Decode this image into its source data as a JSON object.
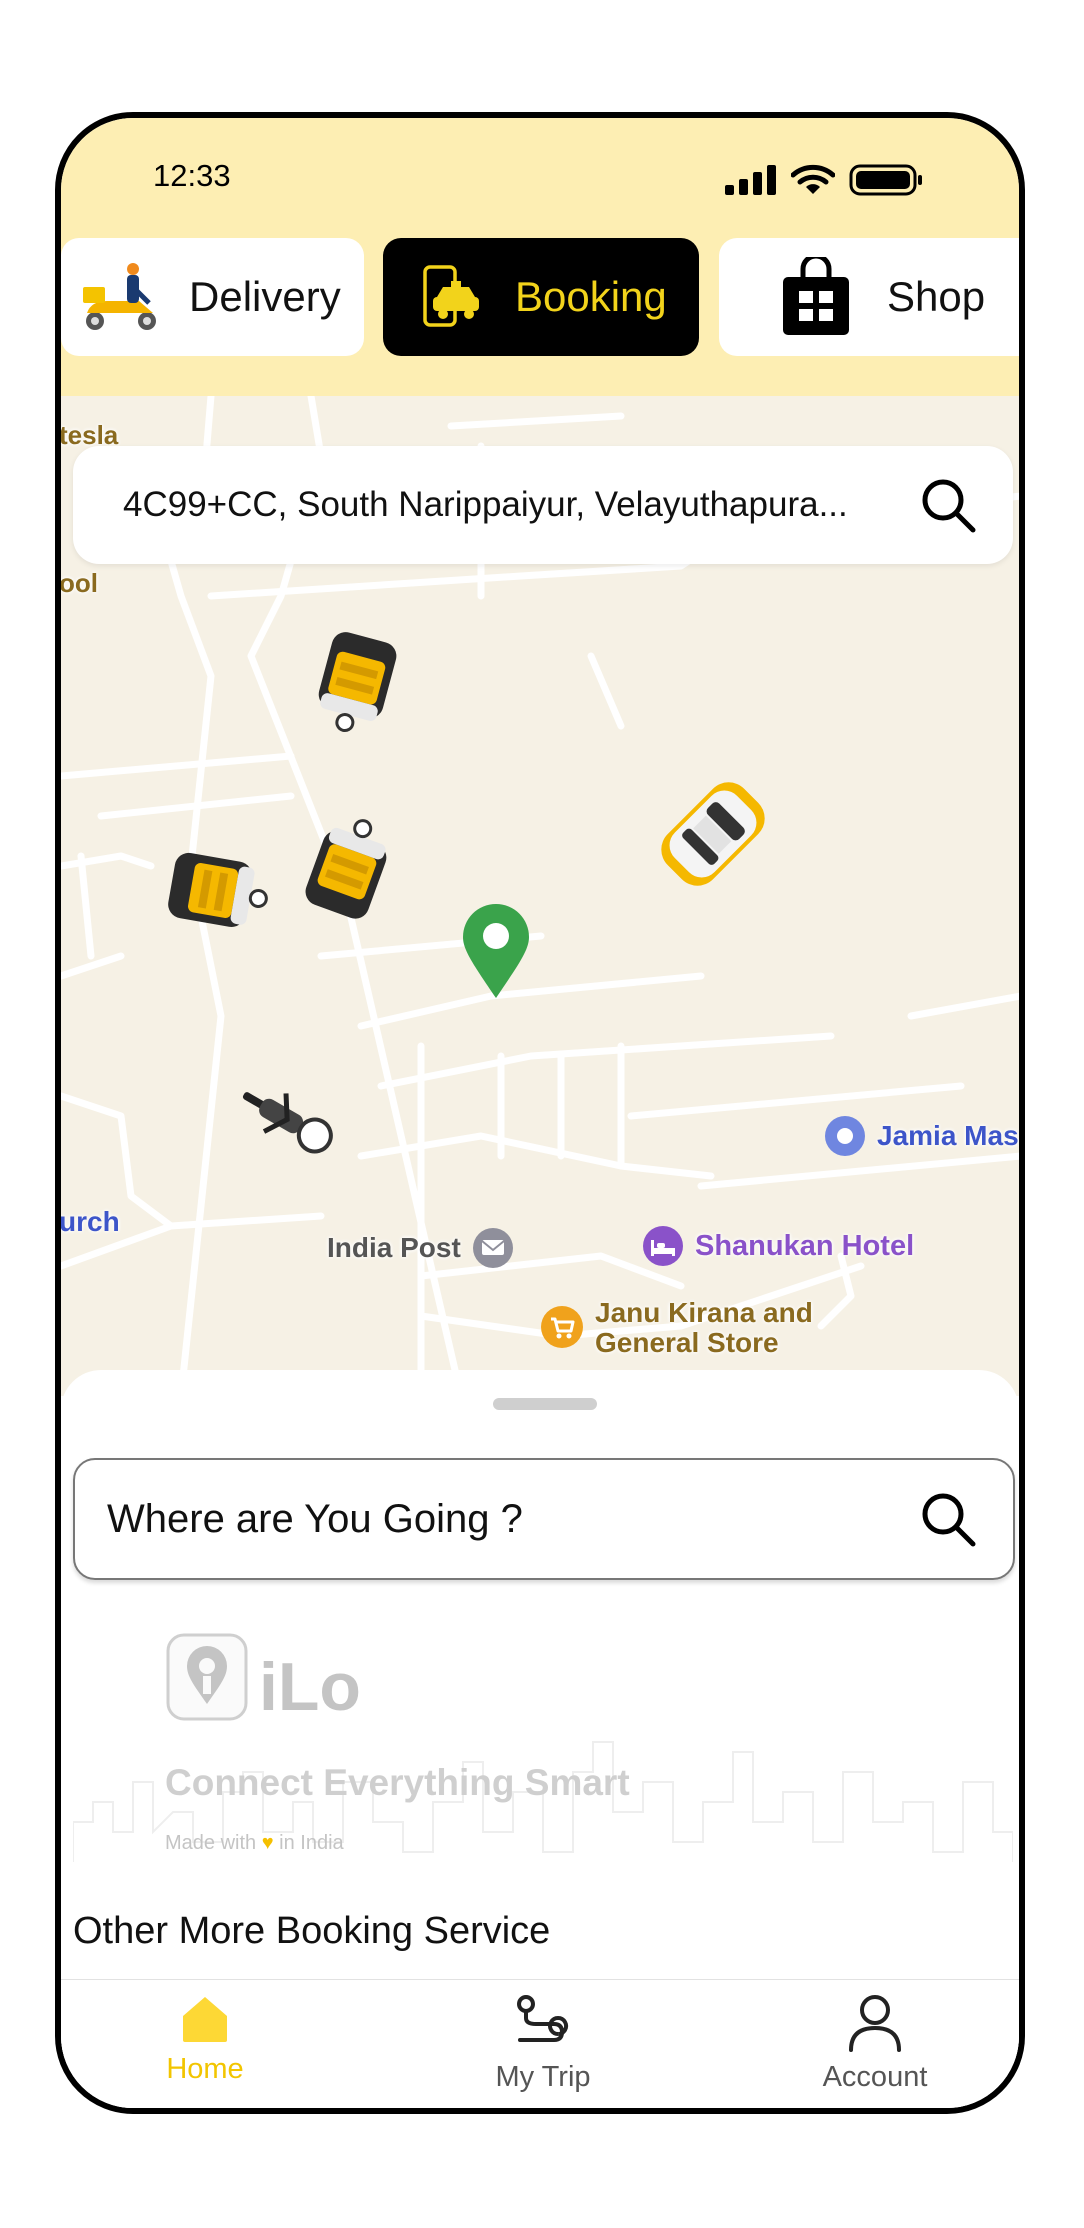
{
  "status": {
    "time": "12:33"
  },
  "tabs": [
    {
      "label": "Delivery",
      "icon": "scooter-delivery-icon"
    },
    {
      "label": "Booking",
      "icon": "phone-taxi-icon",
      "active": true
    },
    {
      "label": "Shop",
      "icon": "shopping-bag-icon"
    }
  ],
  "map": {
    "address": "4C99+CC, South Narippaiyur, Velayuthapura...",
    "pois": {
      "india_post": "India Post",
      "shanukan": "Shanukan Hotel",
      "janu_line1": "Janu Kirana and",
      "janu_line2": "General Store",
      "jamia": "Jamia Mas",
      "church": "urch",
      "school_frag": "ool",
      "top_frag": "tesla"
    }
  },
  "sheet": {
    "search_placeholder": "Where are You Going ?",
    "brand": {
      "name": "iLo",
      "tagline": "Connect Everything Smart",
      "made_prefix": "Made with",
      "made_suffix": "in India"
    },
    "section_title": "Other More Booking Service"
  },
  "nav": {
    "items": [
      {
        "label": "Home",
        "icon": "home-icon",
        "active": true
      },
      {
        "label": "My Trip",
        "icon": "route-icon"
      },
      {
        "label": "Account",
        "icon": "user-icon"
      }
    ]
  },
  "colors": {
    "accent": "#fdd835",
    "active_text": "#f2d31b",
    "header_bg": "#fdeeb3",
    "map_bg": "#f6f1e5",
    "pin": "#3aa34b",
    "poi_purple": "#8a52c9",
    "poi_blue": "#3d55c9",
    "poi_brown": "#8a6a1f"
  }
}
